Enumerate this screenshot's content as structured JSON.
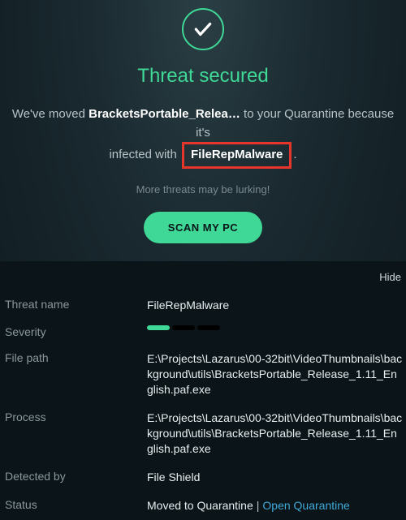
{
  "header": {
    "title": "Threat secured",
    "msg_prefix": "We've moved",
    "filename": "BracketsPortable_Relea…",
    "msg_mid": "to your Quarantine because it's",
    "msg_infected": "infected with",
    "threat_name_box": "FileRepMalware",
    "msg_period": ".",
    "sub_message": "More threats may be lurking!",
    "scan_button": "SCAN MY PC"
  },
  "details": {
    "hide_label": "Hide",
    "rows": {
      "threat_name": {
        "label": "Threat name",
        "value": "FileRepMalware"
      },
      "severity": {
        "label": "Severity",
        "level": 1,
        "max": 3
      },
      "file_path": {
        "label": "File path",
        "value": "E:\\Projects\\Lazarus\\00-32bit\\VideoThumbnails\\background\\utils\\BracketsPortable_Release_1.11_English.paf.exe"
      },
      "process": {
        "label": "Process",
        "value": "E:\\Projects\\Lazarus\\00-32bit\\VideoThumbnails\\background\\utils\\BracketsPortable_Release_1.11_English.paf.exe"
      },
      "detected_by": {
        "label": "Detected by",
        "value": "File Shield"
      },
      "status": {
        "label": "Status",
        "value": "Moved to Quarantine",
        "link_label": "Open Quarantine"
      }
    }
  }
}
